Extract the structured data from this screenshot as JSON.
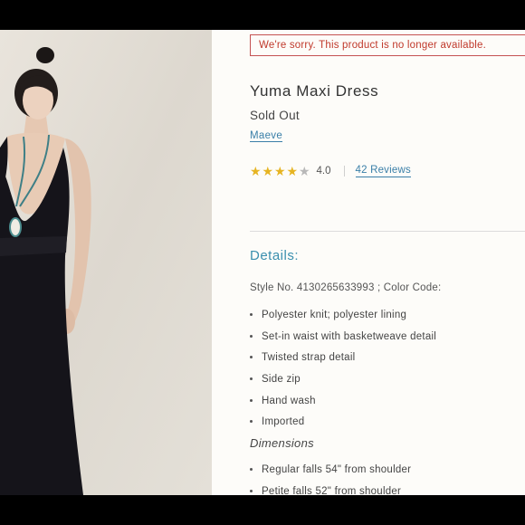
{
  "notice": "We're sorry. This product is no longer available.",
  "product": {
    "title": "Yuma Maxi Dress",
    "status": "Sold Out",
    "brand": "Maeve",
    "rating": {
      "value": "4.0",
      "stars_filled": 4,
      "stars_total": 5,
      "reviews_link": "42 Reviews"
    }
  },
  "details": {
    "heading": "Details:",
    "style_line": "Style No. 4130265633993 ; Color Code:",
    "features": [
      "Polyester knit; polyester lining",
      "Set-in waist with basketweave detail",
      "Twisted strap detail",
      "Side zip",
      "Hand wash",
      "Imported"
    ],
    "dimensions_heading": "Dimensions",
    "dimensions": [
      "Regular falls 54\" from shoulder",
      "Petite falls 52\" from shoulder"
    ]
  },
  "colors": {
    "accent": "#3a8fae",
    "link": "#3a7fa8",
    "notice": "#c0392b",
    "star": "#e6b422"
  }
}
